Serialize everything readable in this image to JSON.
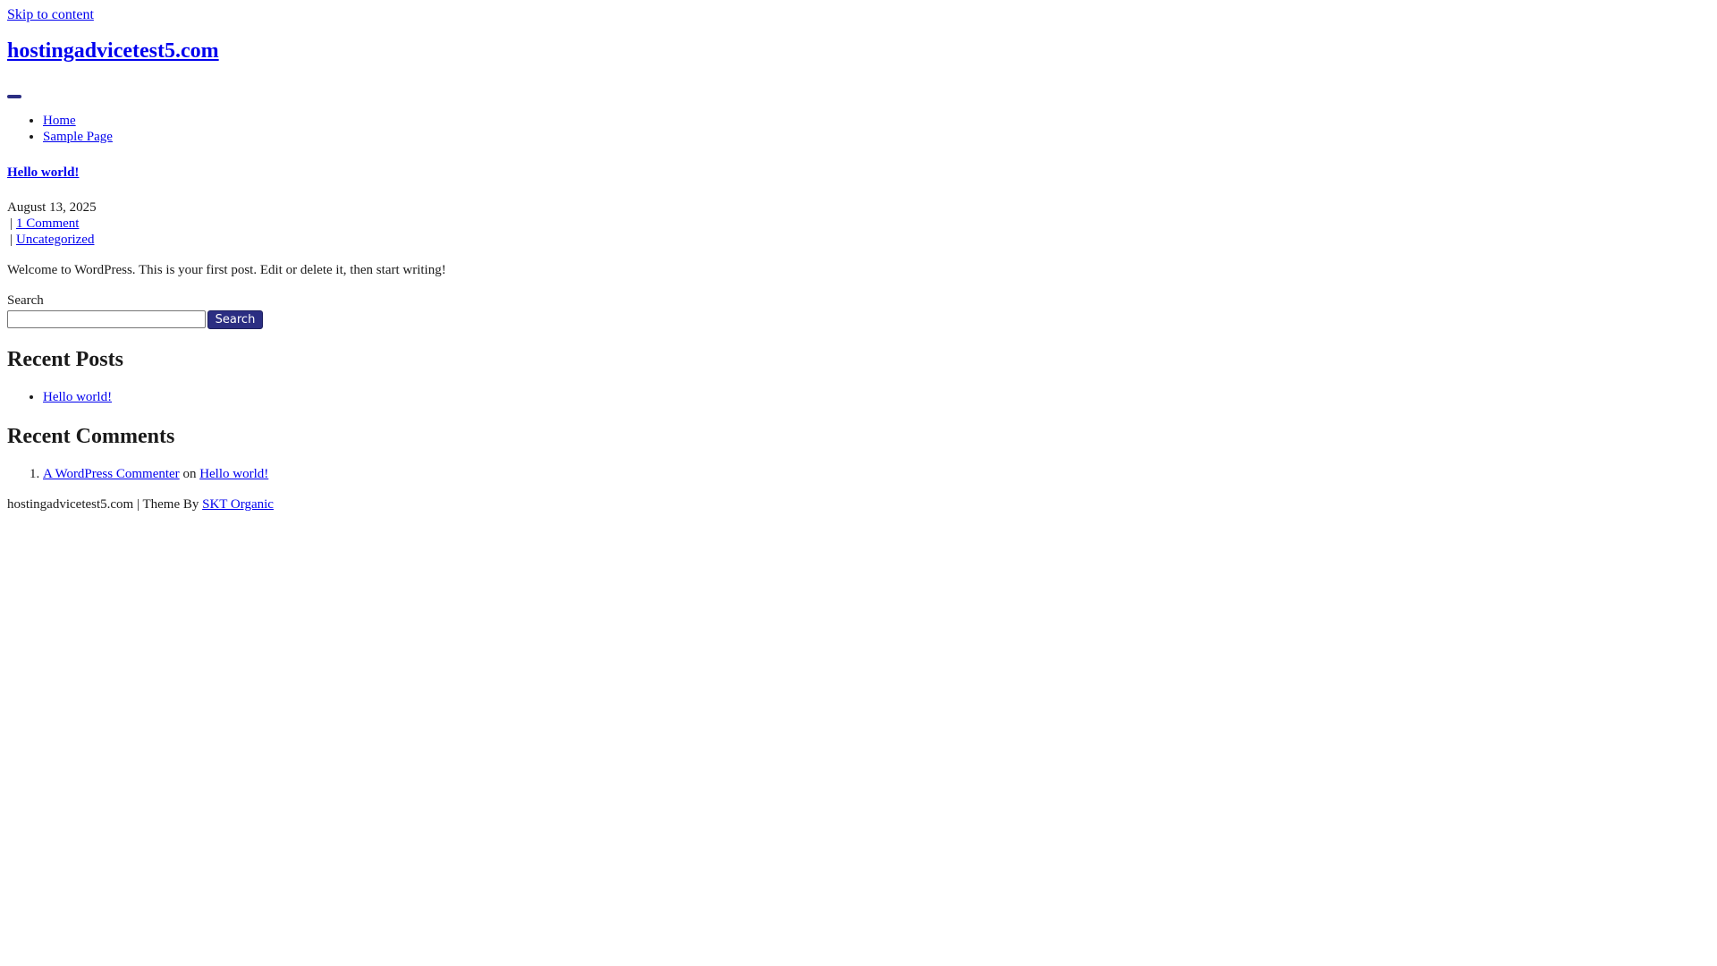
{
  "skip_link": "Skip to content",
  "site_title": "hostingadvicetest5.com",
  "nav": {
    "items": [
      {
        "label": "Home"
      },
      {
        "label": "Sample Page"
      }
    ]
  },
  "post": {
    "title": "Hello world!",
    "date": "August 13, 2025",
    "separator": "|",
    "comments_link": "1 Comment",
    "category_link": "Uncategorized",
    "content": "Welcome to WordPress. This is your first post. Edit or delete it, then start writing!"
  },
  "search": {
    "label": "Search",
    "value": "",
    "button_label": "Search"
  },
  "recent_posts": {
    "title": "Recent Posts",
    "items": [
      {
        "label": "Hello world!"
      }
    ]
  },
  "recent_comments": {
    "title": "Recent Comments",
    "items": [
      {
        "author": "A WordPress Commenter",
        "connector": "on",
        "post": "Hello world!"
      }
    ]
  },
  "footer": {
    "text": "hostingadvicetest5.com | Theme By",
    "link": "SKT Organic"
  },
  "colors": {
    "accent": "#2b2e82",
    "link": "#0000ee"
  }
}
